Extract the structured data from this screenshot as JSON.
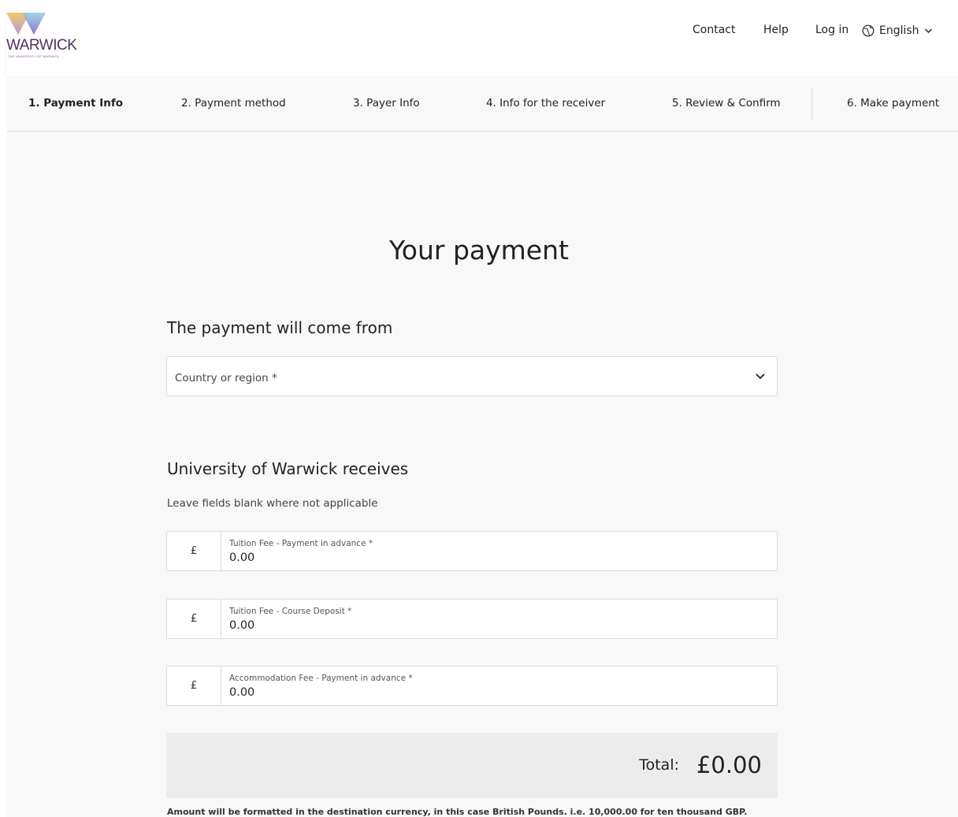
{
  "header": {
    "logo_text": "WARWICK",
    "logo_subtext": "THE UNIVERSITY OF WARWICK",
    "nav": {
      "contact": "Contact",
      "help": "Help",
      "login": "Log in"
    },
    "language": {
      "selected": "English",
      "icon": "globe-icon"
    }
  },
  "steps": [
    {
      "label": "1. Payment Info",
      "active": true
    },
    {
      "label": "2. Payment method",
      "active": false
    },
    {
      "label": "3. Payer Info",
      "active": false
    },
    {
      "label": "4. Info for the receiver",
      "active": false
    },
    {
      "label": "5. Review & Confirm",
      "active": false
    },
    {
      "label": "6. Make payment",
      "active": false
    }
  ],
  "main": {
    "title": "Your payment",
    "from_section": {
      "title": "The payment will come from",
      "country_placeholder": "Country or region *"
    },
    "receives_section": {
      "title": "University of Warwick receives",
      "hint": "Leave fields blank where not applicable",
      "fields": [
        {
          "currency": "£",
          "label": "Tuition Fee - Payment in advance *",
          "value": "0.00"
        },
        {
          "currency": "£",
          "label": "Tuition Fee - Course Deposit *",
          "value": "0.00"
        },
        {
          "currency": "£",
          "label": "Accommodation Fee - Payment in advance *",
          "value": "0.00"
        }
      ]
    },
    "total": {
      "label": "Total:",
      "value": "£0.00"
    },
    "note": "Amount will be formatted in the destination currency, in this case British Pounds. i.e. 10,000.00 for ten thousand GBP."
  },
  "colors": {
    "brand_purple": "#552d62",
    "page_background": "#f8f8f8",
    "total_background": "#ececec"
  }
}
